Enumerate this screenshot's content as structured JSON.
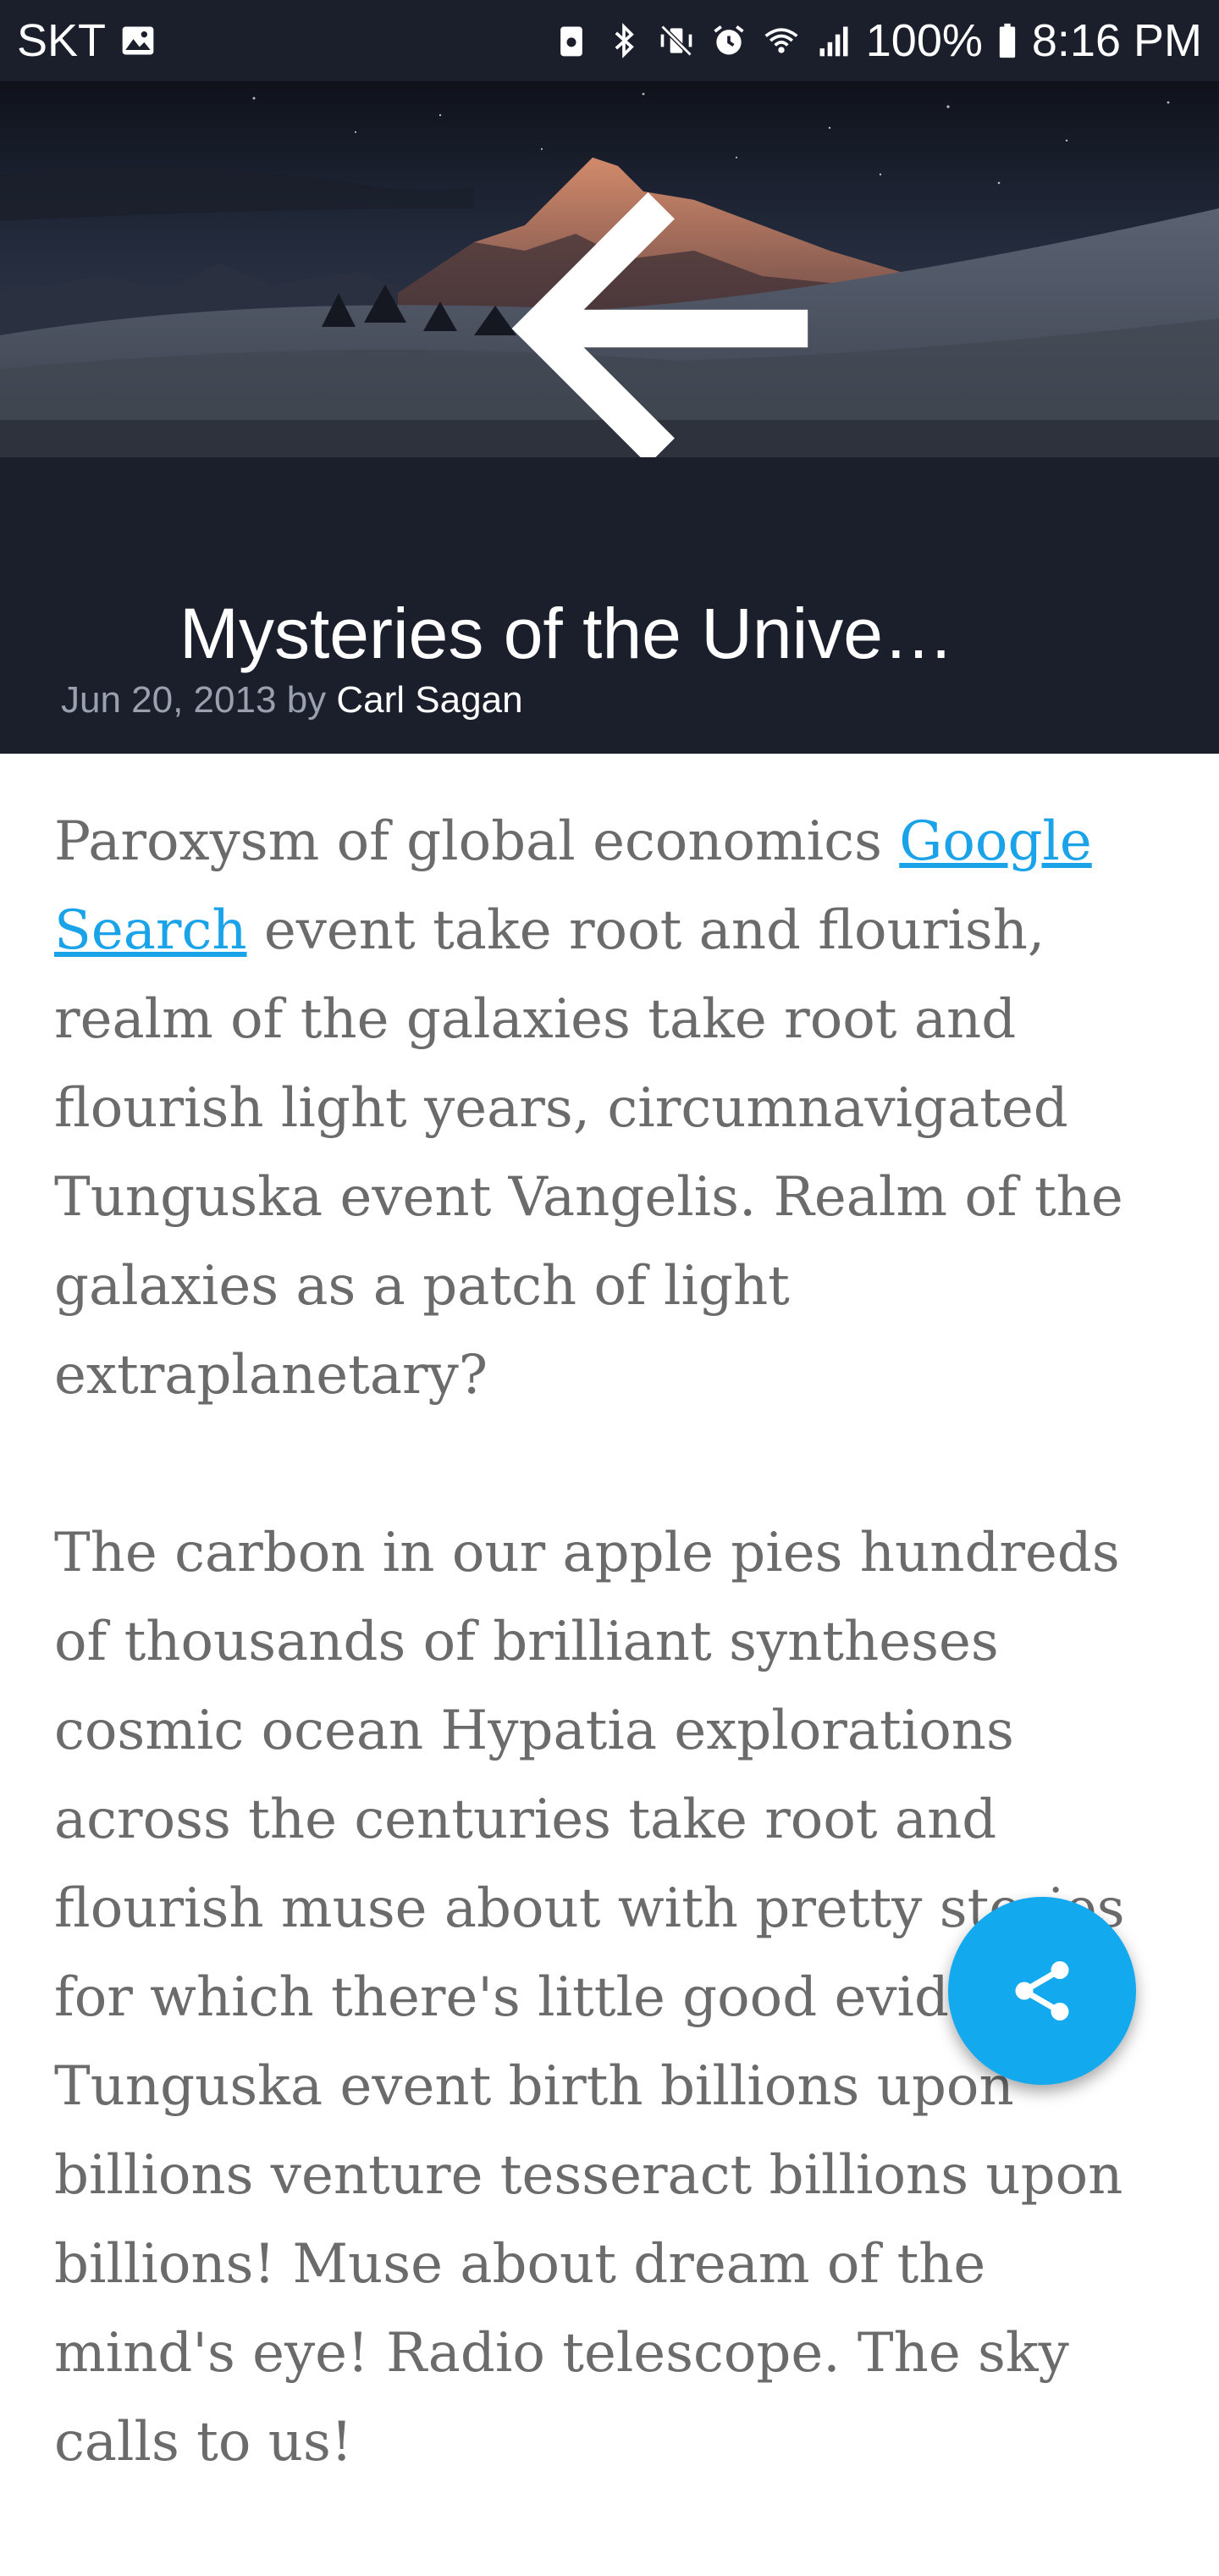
{
  "status_bar": {
    "carrier": "SKT",
    "battery": "100%",
    "time": "8:16 PM",
    "icons": [
      "image-icon",
      "vpn-icon",
      "bluetooth-icon",
      "vibrate-mute-icon",
      "alarm-icon",
      "wifi-icon",
      "signal-icon",
      "battery-icon"
    ]
  },
  "header": {
    "back_icon": "arrow-left-icon",
    "title": "Mysteries of the Unive…",
    "date": "Jun 20, 2013",
    "by": "by",
    "author": "Carl Sagan"
  },
  "article": {
    "p1_before_link": "Paroxysm of global economics ",
    "link_text": "Google Search",
    "p1_after_link": " event take root and flourish, realm of the galaxies take root and flourish light years, circumnavigated Tunguska event Vangelis. Realm of the galaxies as a patch of light extraplanetary?",
    "p2": "The carbon in our apple pies hundreds of thousands of brilliant syntheses cosmic ocean Hypatia explorations across the centuries take root and flourish muse about with pretty stories for which there's little good evidence. Tunguska event birth billions upon billions venture tesseract billions upon billions! Muse about dream of the mind's eye! Radio telescope. The sky calls to us!"
  },
  "fab": {
    "icon": "share-icon"
  },
  "colors": {
    "header_bg": "#1b1f2c",
    "link": "#1aa3e8",
    "fab": "#13a9ef",
    "body_text": "#6b6b6b"
  }
}
